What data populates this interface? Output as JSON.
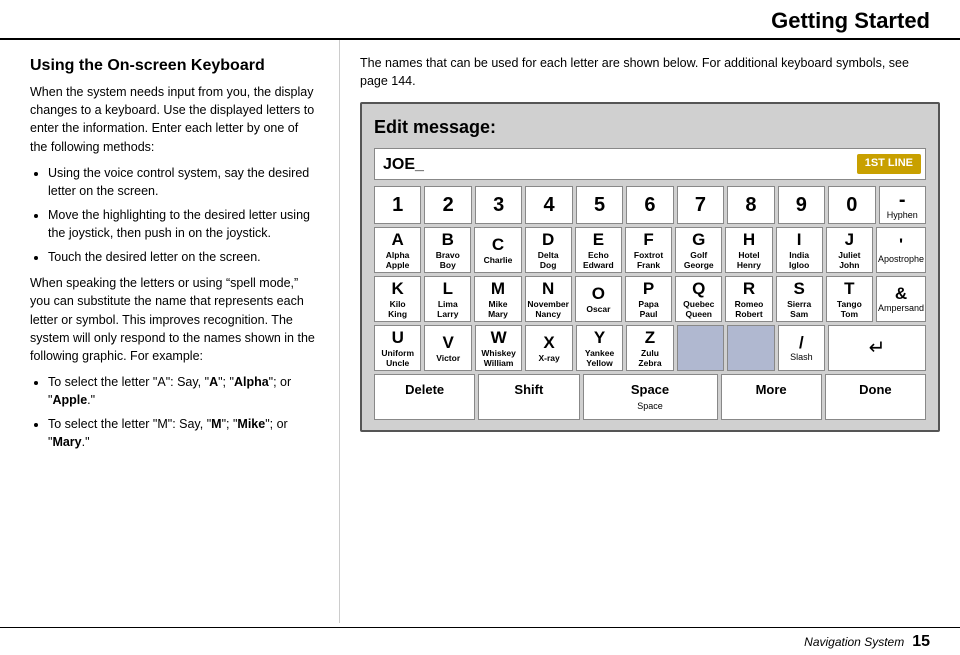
{
  "header": {
    "title": "Getting Started"
  },
  "footer": {
    "label": "Navigation System",
    "page": "15"
  },
  "left": {
    "heading": "Using the On-screen Keyboard",
    "para1": "When the system needs input from you, the display changes to a keyboard. Use the displayed letters to enter the information. Enter each letter by one of the following methods:",
    "bullets": [
      "Using the voice control system, say the desired letter on the screen.",
      "Move the highlighting to the desired letter using the joystick, then push in on the joystick.",
      "Touch the desired letter on the screen."
    ],
    "para2": "When speaking the letters or using “spell mode,” you can substitute the name that represents each letter or symbol. This improves recognition. The system will only respond to the names shown in the following graphic. For example:",
    "examples": [
      "To select the letter “A”: Say, “A”; “Alpha”; or “Apple.”",
      "To select the letter “M”: Say, “M”; “Mike”; or “Mary.”"
    ]
  },
  "right": {
    "desc": "The names that can be used for each letter are shown below. For additional keyboard symbols, see page 144.",
    "keyboard": {
      "title": "Edit message:",
      "input_value": "JOE_",
      "line_badge": "1ST LINE",
      "rows": [
        [
          {
            "main": "1",
            "sub": "",
            "name": ""
          },
          {
            "main": "2",
            "sub": "",
            "name": ""
          },
          {
            "main": "3",
            "sub": "",
            "name": ""
          },
          {
            "main": "4",
            "sub": "",
            "name": ""
          },
          {
            "main": "5",
            "sub": "",
            "name": ""
          },
          {
            "main": "6",
            "sub": "",
            "name": ""
          },
          {
            "main": "7",
            "sub": "",
            "name": ""
          },
          {
            "main": "8",
            "sub": "",
            "name": ""
          },
          {
            "main": "9",
            "sub": "",
            "name": ""
          },
          {
            "main": "0",
            "sub": "",
            "name": ""
          },
          {
            "main": "-",
            "sub": "Hyphen",
            "name": ""
          }
        ],
        [
          {
            "main": "A",
            "sub": "",
            "name": "Alpha\nApple"
          },
          {
            "main": "B",
            "sub": "",
            "name": "Bravo\nBoy"
          },
          {
            "main": "C",
            "sub": "",
            "name": "Charlie"
          },
          {
            "main": "D",
            "sub": "",
            "name": "Delta\nDog"
          },
          {
            "main": "E",
            "sub": "",
            "name": "Echo\nEdward"
          },
          {
            "main": "F",
            "sub": "",
            "name": "Foxtrot\nFrank"
          },
          {
            "main": "G",
            "sub": "",
            "name": "Golf\nGeorge"
          },
          {
            "main": "H",
            "sub": "",
            "name": "Hotel\nHenry"
          },
          {
            "main": "I",
            "sub": "",
            "name": "India\nIgloo"
          },
          {
            "main": "J",
            "sub": "",
            "name": "Juliet\nJohn"
          },
          {
            "main": "'",
            "sub": "Apostrophe",
            "name": ""
          }
        ],
        [
          {
            "main": "K",
            "sub": "",
            "name": "Kilo\nKing"
          },
          {
            "main": "L",
            "sub": "",
            "name": "Lima\nLarry"
          },
          {
            "main": "M",
            "sub": "",
            "name": "Mike\nMary"
          },
          {
            "main": "N",
            "sub": "",
            "name": "November\nNancy"
          },
          {
            "main": "O",
            "sub": "",
            "name": "Oscar"
          },
          {
            "main": "P",
            "sub": "",
            "name": "Papa\nPaul"
          },
          {
            "main": "Q",
            "sub": "",
            "name": "Quebec\nQueen"
          },
          {
            "main": "R",
            "sub": "",
            "name": "Romeo\nRobert"
          },
          {
            "main": "S",
            "sub": "",
            "name": "Sierra\nSam"
          },
          {
            "main": "T",
            "sub": "",
            "name": "Tango\nTom"
          },
          {
            "main": "&",
            "sub": "Ampersand",
            "name": ""
          }
        ],
        [
          {
            "main": "U",
            "sub": "",
            "name": "Uniform\nUncle"
          },
          {
            "main": "V",
            "sub": "",
            "name": "Victor"
          },
          {
            "main": "W",
            "sub": "",
            "name": "Whiskey\nWilliam"
          },
          {
            "main": "X",
            "sub": "",
            "name": "X-ray"
          },
          {
            "main": "Y",
            "sub": "",
            "name": "Yankee\nYellow"
          },
          {
            "main": "Z",
            "sub": "",
            "name": "Zulu\nZebra"
          },
          {
            "main": "",
            "sub": "",
            "name": "",
            "highlighted": true
          },
          {
            "main": "",
            "sub": "",
            "name": "",
            "highlighted": true
          },
          {
            "main": "/",
            "sub": "Slash",
            "name": ""
          },
          {
            "main": "↵",
            "sub": "",
            "name": "",
            "colspan": true
          },
          {
            "main": "",
            "sub": "",
            "name": "",
            "skip": true
          }
        ]
      ],
      "bottom_buttons": [
        {
          "label": "Delete",
          "sub": ""
        },
        {
          "label": "Shift",
          "sub": ""
        },
        {
          "label": "Space",
          "sub": "Space"
        },
        {
          "label": "More",
          "sub": ""
        },
        {
          "label": "Done",
          "sub": ""
        }
      ]
    }
  }
}
